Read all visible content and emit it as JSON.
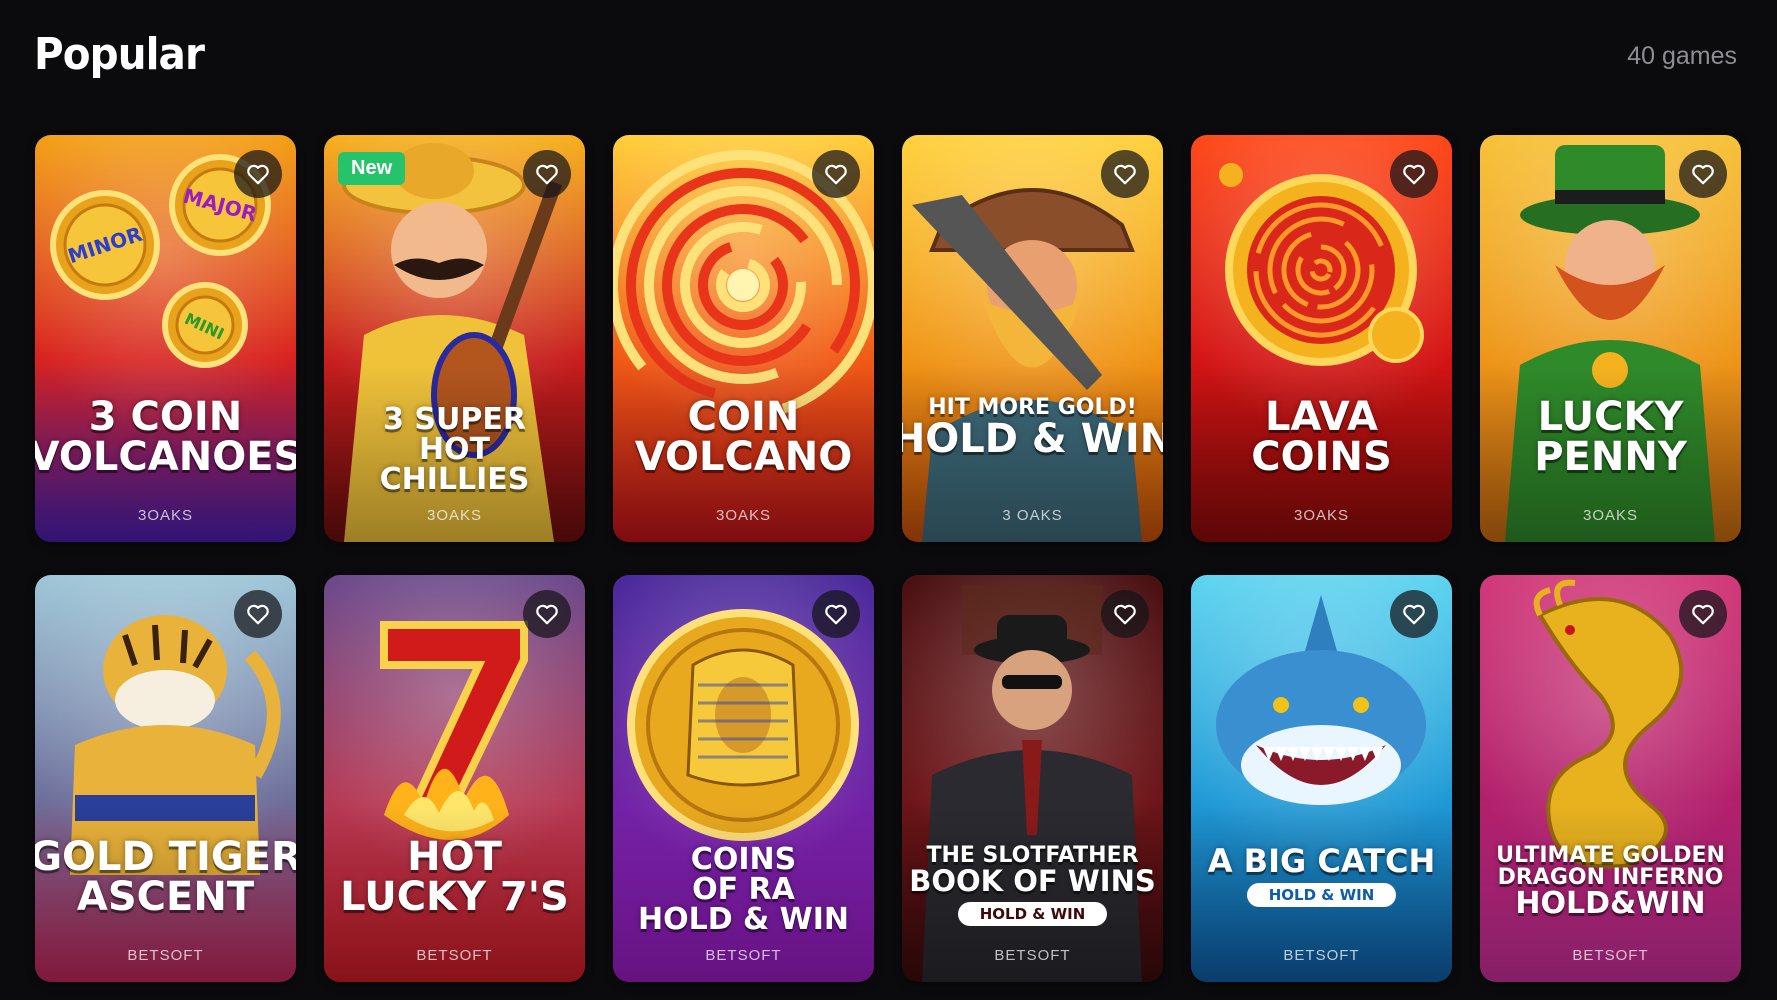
{
  "section": {
    "title": "Popular",
    "count": "40 games"
  },
  "games": [
    {
      "lines": [
        "3 COIN",
        "VOLCANOES"
      ],
      "provider": "3OAKS",
      "badge": "",
      "art": "coin-volcanoes",
      "colors": [
        "#f3a218",
        "#d8221e",
        "#4a1fb3"
      ],
      "medallions": [
        "MINOR",
        "MAJOR",
        "MINI"
      ]
    },
    {
      "lines": [
        "3 SUPER",
        "HOT",
        "CHILLIES"
      ],
      "provider": "3OAKS",
      "badge": "New",
      "art": "mariachi",
      "colors": [
        "#f6b21f",
        "#c81e1e",
        "#6d0d0d"
      ]
    },
    {
      "lines": [
        "COIN",
        "VOLCANO"
      ],
      "provider": "3OAKS",
      "badge": "",
      "art": "swirl",
      "colors": [
        "#ffcf3a",
        "#f05a15",
        "#c1121a"
      ]
    },
    {
      "lines": [
        "HIT MORE GOLD!",
        "HOLD & WIN"
      ],
      "provider": "3 OAKS",
      "badge": "",
      "art": "miner",
      "colors": [
        "#ffd23f",
        "#f09415",
        "#c64f0a"
      ]
    },
    {
      "lines": [
        "LAVA",
        "COINS"
      ],
      "provider": "3OAKS",
      "badge": "",
      "art": "lava-coin",
      "colors": [
        "#ff4a1a",
        "#d41414",
        "#8e0a0a"
      ]
    },
    {
      "lines": [
        "LUCKY",
        "PENNY"
      ],
      "provider": "3OAKS",
      "badge": "",
      "art": "leprechaun",
      "colors": [
        "#f7c23a",
        "#ee9518",
        "#c86a10"
      ]
    },
    {
      "lines": [
        "GOLD TIGER",
        "ASCENT"
      ],
      "provider": "BETSOFT",
      "badge": "",
      "art": "tiger",
      "colors": [
        "#9fc7d8",
        "#6c6f9a",
        "#c4275a"
      ]
    },
    {
      "lines": [
        "HOT",
        "LUCKY 7'S"
      ],
      "provider": "BETSOFT",
      "badge": "",
      "art": "seven",
      "colors": [
        "#6b4a8c",
        "#b53a55",
        "#d21c26"
      ]
    },
    {
      "lines": [
        "COINS",
        "OF RA",
        "HOLD & WIN"
      ],
      "provider": "BETSOFT",
      "badge": "",
      "art": "pharaoh",
      "colors": [
        "#4a2a9c",
        "#7022a6",
        "#9b1cc4"
      ]
    },
    {
      "lines": [
        "THE SLOTFATHER",
        "BOOK OF WINS"
      ],
      "pill": "HOLD & WIN",
      "provider": "BETSOFT",
      "badge": "",
      "art": "mobster",
      "colors": [
        "#4a1012",
        "#6e1518",
        "#3c0a0c"
      ]
    },
    {
      "lines": [
        "A BIG CATCH"
      ],
      "pill": "HOLD & WIN",
      "provider": "BETSOFT",
      "badge": "",
      "art": "shark",
      "colors": [
        "#5fd4f0",
        "#1f9ad6",
        "#0e5ea6"
      ]
    },
    {
      "lines": [
        "ULTIMATE GOLDEN",
        "DRAGON INFERNO",
        "HOLD&WIN"
      ],
      "provider": "BETSOFT",
      "badge": "",
      "art": "dragon",
      "colors": [
        "#d23a7a",
        "#b21f6a",
        "#cc2f9c"
      ]
    }
  ]
}
